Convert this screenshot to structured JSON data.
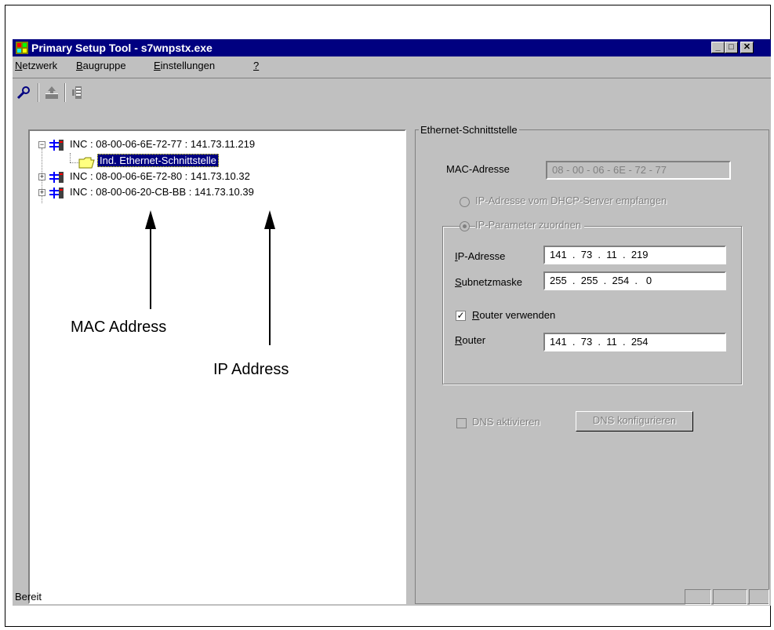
{
  "window": {
    "title": "Primary Setup Tool - s7wnpstx.exe",
    "buttons": {
      "minimize": "_",
      "maximize": "□",
      "close": "✕"
    }
  },
  "menu": [
    {
      "underline": "N",
      "rest": "etzwerk"
    },
    {
      "underline": "B",
      "rest": "augruppe"
    },
    {
      "underline": "E",
      "rest": "instellungen"
    },
    {
      "underline": "?",
      "rest": ""
    }
  ],
  "toolbar": {
    "icons": [
      "browse-network-icon",
      "upload-module-icon",
      "download-module-icon"
    ]
  },
  "tree": {
    "items": [
      {
        "label": "INC : 08-00-06-6E-72-77 : 141.73.11.219",
        "expander": "−"
      },
      {
        "label": "Ind. Ethernet-Schnittstelle"
      },
      {
        "label": "INC : 08-00-06-6E-72-80 : 141.73.10.32",
        "expander": "+"
      },
      {
        "label": "INC : 08-00-06-20-CB-BB : 141.73.10.39",
        "expander": "+"
      }
    ]
  },
  "panel": {
    "group_title": "Ethernet-Schnittstelle",
    "mac_label": "MAC-Adresse",
    "mac_value": "08 - 00 - 06 - 6E - 72 - 77",
    "radio_dhcp": "IP-Adresse vom DHCP-Server empfangen",
    "radio_assign": "IP-Parameter zuordnen",
    "ip_label_u": "I",
    "ip_label_rest": "P-Adresse",
    "ip_value": "141  .  73  .  11  .  219",
    "subnet_label_u": "S",
    "subnet_label_rest": "ubnetzmaske",
    "subnet_value": "255  .  255  .  254  .   0",
    "router_check_u": "R",
    "router_check_rest": "outer verwenden",
    "router_checked": "✓",
    "router_label_u": "R",
    "router_label_rest": "outer",
    "router_value": "141  .  73  .  11  .  254",
    "dns_check": "DNS aktivieren",
    "dns_button": "DNS konfigurieren"
  },
  "status": {
    "text": "Bereit"
  },
  "annotations": {
    "mac": "MAC Address",
    "ip": "IP Address"
  }
}
